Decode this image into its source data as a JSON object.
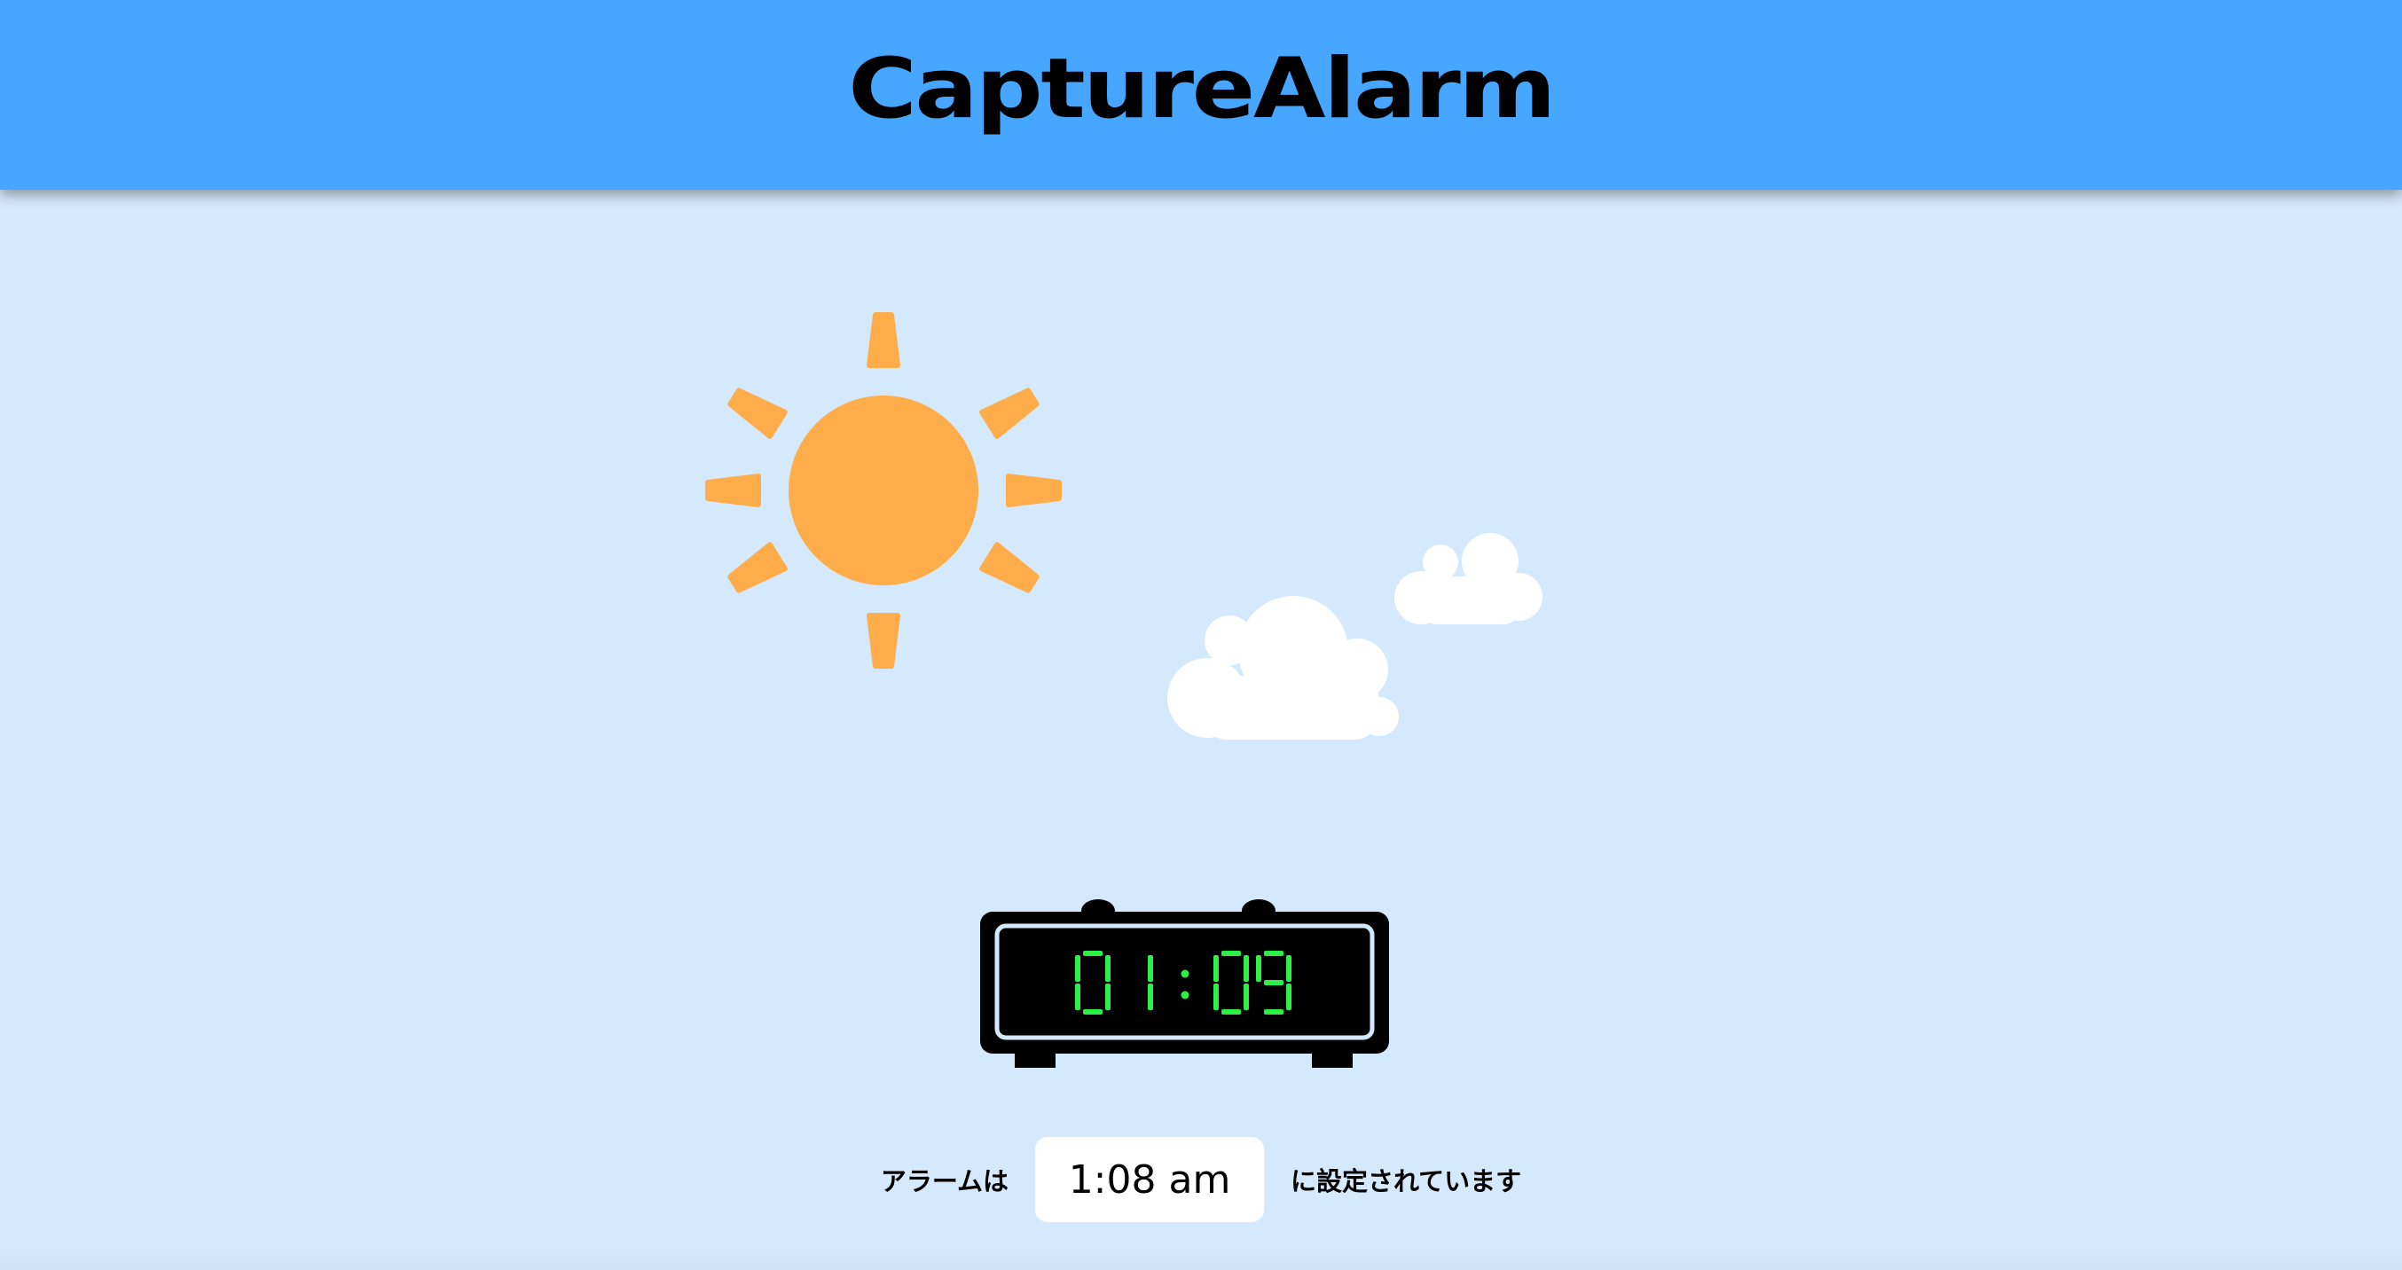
{
  "app": {
    "title": "CaptureAlarm"
  },
  "clock": {
    "hours": "01",
    "separator": ":",
    "minutes": "09",
    "digit_color": "#2cf045"
  },
  "alarm": {
    "prefix": "アラームは",
    "time_value": "1:08 am",
    "suffix": "に設定されています"
  },
  "colors": {
    "header": "#47a6ff",
    "background": "#d5e9fc",
    "sun": "#ffad4a",
    "cloud": "#ffffff"
  },
  "icons": [
    "sun-icon",
    "cloud-icon",
    "alarm-clock-icon"
  ]
}
